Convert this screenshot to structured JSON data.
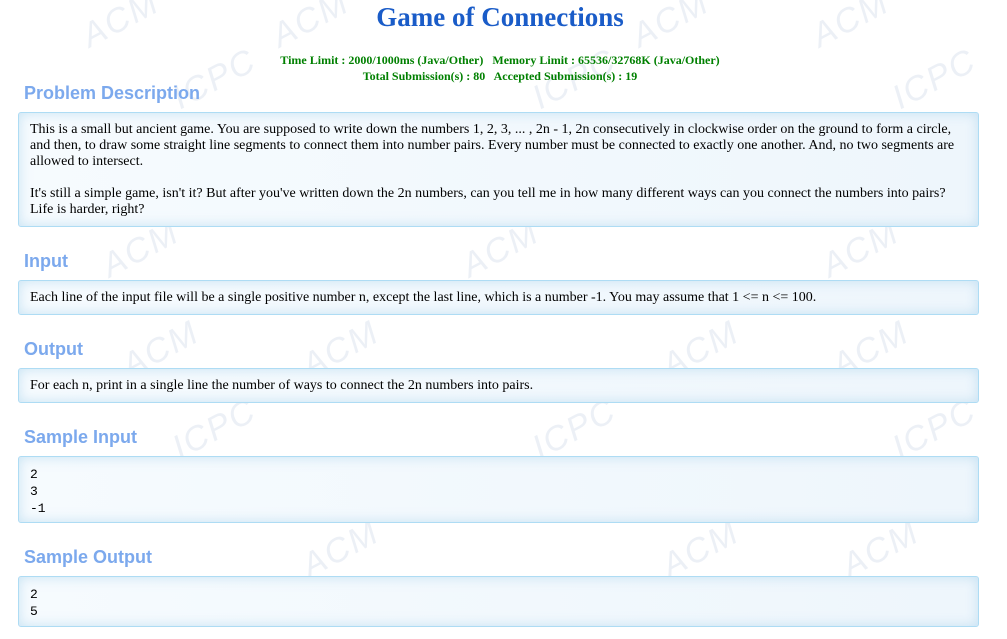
{
  "problem": {
    "title": "Game of Connections",
    "limits": {
      "time": "Time Limit : 2000/1000ms (Java/Other)",
      "memory": "Memory Limit : 65536/32768K (Java/Other)",
      "total": "Total Submission(s) : 80",
      "accepted": "Accepted Submission(s) : 19"
    }
  },
  "sections": {
    "description": {
      "heading": "Problem Description",
      "paragraphs": [
        "This is a small but ancient game. You are supposed to write down the numbers 1, 2, 3, ... , 2n - 1, 2n consecutively in clockwise order on the ground to form a circle, and then, to draw some straight line segments to connect them into number pairs. Every number must be connected to exactly one another. And, no two segments are allowed to intersect.",
        "It's still a simple game, isn't it? But after you've written down the 2n numbers, can you tell me in how many different ways can you connect the numbers into pairs? Life is harder, right?"
      ]
    },
    "input": {
      "heading": "Input",
      "text": "Each line of the input file will be a single positive number n, except the last line, which is a number -1. You may assume that 1 <= n <= 100."
    },
    "output": {
      "heading": "Output",
      "text": "For each n, print in a single line the number of ways to connect the 2n numbers into pairs."
    },
    "sample_input": {
      "heading": "Sample Input",
      "lines": [
        "2",
        "3",
        "-1"
      ]
    },
    "sample_output": {
      "heading": "Sample Output",
      "lines": [
        "2",
        "5"
      ]
    }
  },
  "watermark": {
    "texts": [
      "ACM",
      "ICPC"
    ],
    "color": "#c8d4e4"
  },
  "colors": {
    "title": "#1a5cc8",
    "stats": "#008000",
    "heading": "#7ca9ed",
    "panel_border": "#aedcf4"
  }
}
